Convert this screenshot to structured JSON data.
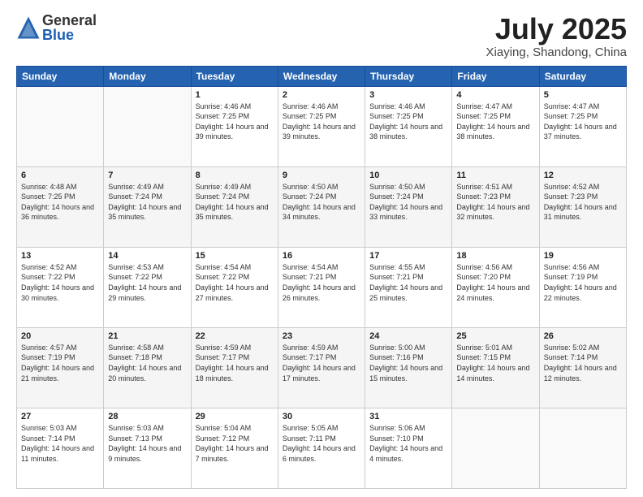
{
  "logo": {
    "general": "General",
    "blue": "Blue"
  },
  "title": {
    "month_year": "July 2025",
    "location": "Xiaying, Shandong, China"
  },
  "headers": [
    "Sunday",
    "Monday",
    "Tuesday",
    "Wednesday",
    "Thursday",
    "Friday",
    "Saturday"
  ],
  "weeks": [
    [
      {
        "day": "",
        "info": ""
      },
      {
        "day": "",
        "info": ""
      },
      {
        "day": "1",
        "info": "Sunrise: 4:46 AM\nSunset: 7:25 PM\nDaylight: 14 hours and 39 minutes."
      },
      {
        "day": "2",
        "info": "Sunrise: 4:46 AM\nSunset: 7:25 PM\nDaylight: 14 hours and 39 minutes."
      },
      {
        "day": "3",
        "info": "Sunrise: 4:46 AM\nSunset: 7:25 PM\nDaylight: 14 hours and 38 minutes."
      },
      {
        "day": "4",
        "info": "Sunrise: 4:47 AM\nSunset: 7:25 PM\nDaylight: 14 hours and 38 minutes."
      },
      {
        "day": "5",
        "info": "Sunrise: 4:47 AM\nSunset: 7:25 PM\nDaylight: 14 hours and 37 minutes."
      }
    ],
    [
      {
        "day": "6",
        "info": "Sunrise: 4:48 AM\nSunset: 7:25 PM\nDaylight: 14 hours and 36 minutes."
      },
      {
        "day": "7",
        "info": "Sunrise: 4:49 AM\nSunset: 7:24 PM\nDaylight: 14 hours and 35 minutes."
      },
      {
        "day": "8",
        "info": "Sunrise: 4:49 AM\nSunset: 7:24 PM\nDaylight: 14 hours and 35 minutes."
      },
      {
        "day": "9",
        "info": "Sunrise: 4:50 AM\nSunset: 7:24 PM\nDaylight: 14 hours and 34 minutes."
      },
      {
        "day": "10",
        "info": "Sunrise: 4:50 AM\nSunset: 7:24 PM\nDaylight: 14 hours and 33 minutes."
      },
      {
        "day": "11",
        "info": "Sunrise: 4:51 AM\nSunset: 7:23 PM\nDaylight: 14 hours and 32 minutes."
      },
      {
        "day": "12",
        "info": "Sunrise: 4:52 AM\nSunset: 7:23 PM\nDaylight: 14 hours and 31 minutes."
      }
    ],
    [
      {
        "day": "13",
        "info": "Sunrise: 4:52 AM\nSunset: 7:22 PM\nDaylight: 14 hours and 30 minutes."
      },
      {
        "day": "14",
        "info": "Sunrise: 4:53 AM\nSunset: 7:22 PM\nDaylight: 14 hours and 29 minutes."
      },
      {
        "day": "15",
        "info": "Sunrise: 4:54 AM\nSunset: 7:22 PM\nDaylight: 14 hours and 27 minutes."
      },
      {
        "day": "16",
        "info": "Sunrise: 4:54 AM\nSunset: 7:21 PM\nDaylight: 14 hours and 26 minutes."
      },
      {
        "day": "17",
        "info": "Sunrise: 4:55 AM\nSunset: 7:21 PM\nDaylight: 14 hours and 25 minutes."
      },
      {
        "day": "18",
        "info": "Sunrise: 4:56 AM\nSunset: 7:20 PM\nDaylight: 14 hours and 24 minutes."
      },
      {
        "day": "19",
        "info": "Sunrise: 4:56 AM\nSunset: 7:19 PM\nDaylight: 14 hours and 22 minutes."
      }
    ],
    [
      {
        "day": "20",
        "info": "Sunrise: 4:57 AM\nSunset: 7:19 PM\nDaylight: 14 hours and 21 minutes."
      },
      {
        "day": "21",
        "info": "Sunrise: 4:58 AM\nSunset: 7:18 PM\nDaylight: 14 hours and 20 minutes."
      },
      {
        "day": "22",
        "info": "Sunrise: 4:59 AM\nSunset: 7:17 PM\nDaylight: 14 hours and 18 minutes."
      },
      {
        "day": "23",
        "info": "Sunrise: 4:59 AM\nSunset: 7:17 PM\nDaylight: 14 hours and 17 minutes."
      },
      {
        "day": "24",
        "info": "Sunrise: 5:00 AM\nSunset: 7:16 PM\nDaylight: 14 hours and 15 minutes."
      },
      {
        "day": "25",
        "info": "Sunrise: 5:01 AM\nSunset: 7:15 PM\nDaylight: 14 hours and 14 minutes."
      },
      {
        "day": "26",
        "info": "Sunrise: 5:02 AM\nSunset: 7:14 PM\nDaylight: 14 hours and 12 minutes."
      }
    ],
    [
      {
        "day": "27",
        "info": "Sunrise: 5:03 AM\nSunset: 7:14 PM\nDaylight: 14 hours and 11 minutes."
      },
      {
        "day": "28",
        "info": "Sunrise: 5:03 AM\nSunset: 7:13 PM\nDaylight: 14 hours and 9 minutes."
      },
      {
        "day": "29",
        "info": "Sunrise: 5:04 AM\nSunset: 7:12 PM\nDaylight: 14 hours and 7 minutes."
      },
      {
        "day": "30",
        "info": "Sunrise: 5:05 AM\nSunset: 7:11 PM\nDaylight: 14 hours and 6 minutes."
      },
      {
        "day": "31",
        "info": "Sunrise: 5:06 AM\nSunset: 7:10 PM\nDaylight: 14 hours and 4 minutes."
      },
      {
        "day": "",
        "info": ""
      },
      {
        "day": "",
        "info": ""
      }
    ]
  ]
}
